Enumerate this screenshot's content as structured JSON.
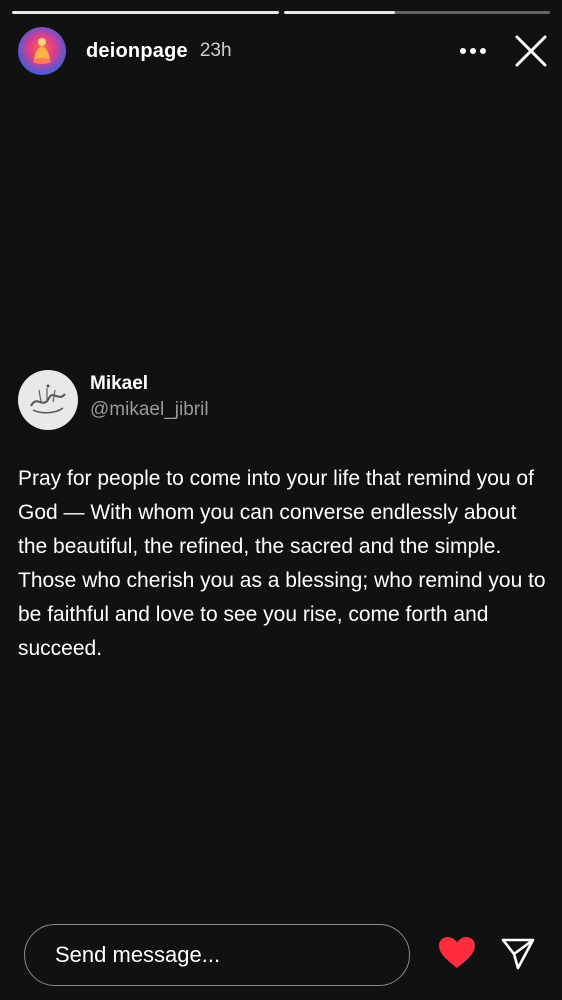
{
  "story": {
    "progress": [
      1.0,
      0.42
    ],
    "user": "deionpage",
    "time": "23h",
    "icons": {
      "more": "more-options-icon",
      "close": "close-icon"
    }
  },
  "post": {
    "author_name": "Mikael",
    "author_handle": "@mikael_jibril",
    "text": "Pray for people to come into your life that remind you of God — With whom you can converse endlessly about the beautiful, the refined, the sacred and the simple. Those who cherish you as a blessing; who remind you to be faithful and love to see you rise, come forth and succeed."
  },
  "footer": {
    "message_placeholder": "Send message...",
    "like_color": "#ff2d3d"
  }
}
